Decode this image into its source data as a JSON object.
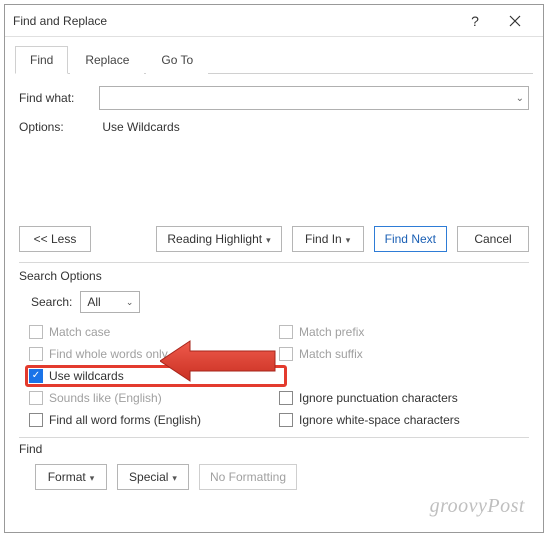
{
  "titlebar": {
    "title": "Find and Replace"
  },
  "tabs": {
    "find": "Find",
    "replace": "Replace",
    "goto": "Go To"
  },
  "findwhat": {
    "label": "Find what:"
  },
  "options": {
    "label": "Options:",
    "value": "Use Wildcards"
  },
  "buttons": {
    "less": "<< Less",
    "reading": "Reading Highlight",
    "findin": "Find In",
    "findnext": "Find Next",
    "cancel": "Cancel"
  },
  "search_options": {
    "title": "Search Options",
    "search_label": "Search:",
    "search_value": "All"
  },
  "checks": {
    "match_case": "Match case",
    "whole_words": "Find whole words only",
    "use_wildcards": "Use wildcards",
    "sounds_like": "Sounds like (English)",
    "word_forms": "Find all word forms (English)",
    "match_prefix": "Match prefix",
    "match_suffix": "Match suffix",
    "ignore_punct": "Ignore punctuation characters",
    "ignore_ws": "Ignore white-space characters"
  },
  "find": {
    "title": "Find",
    "format": "Format",
    "special": "Special",
    "noformat": "No Formatting"
  },
  "watermark": "groovyPost"
}
